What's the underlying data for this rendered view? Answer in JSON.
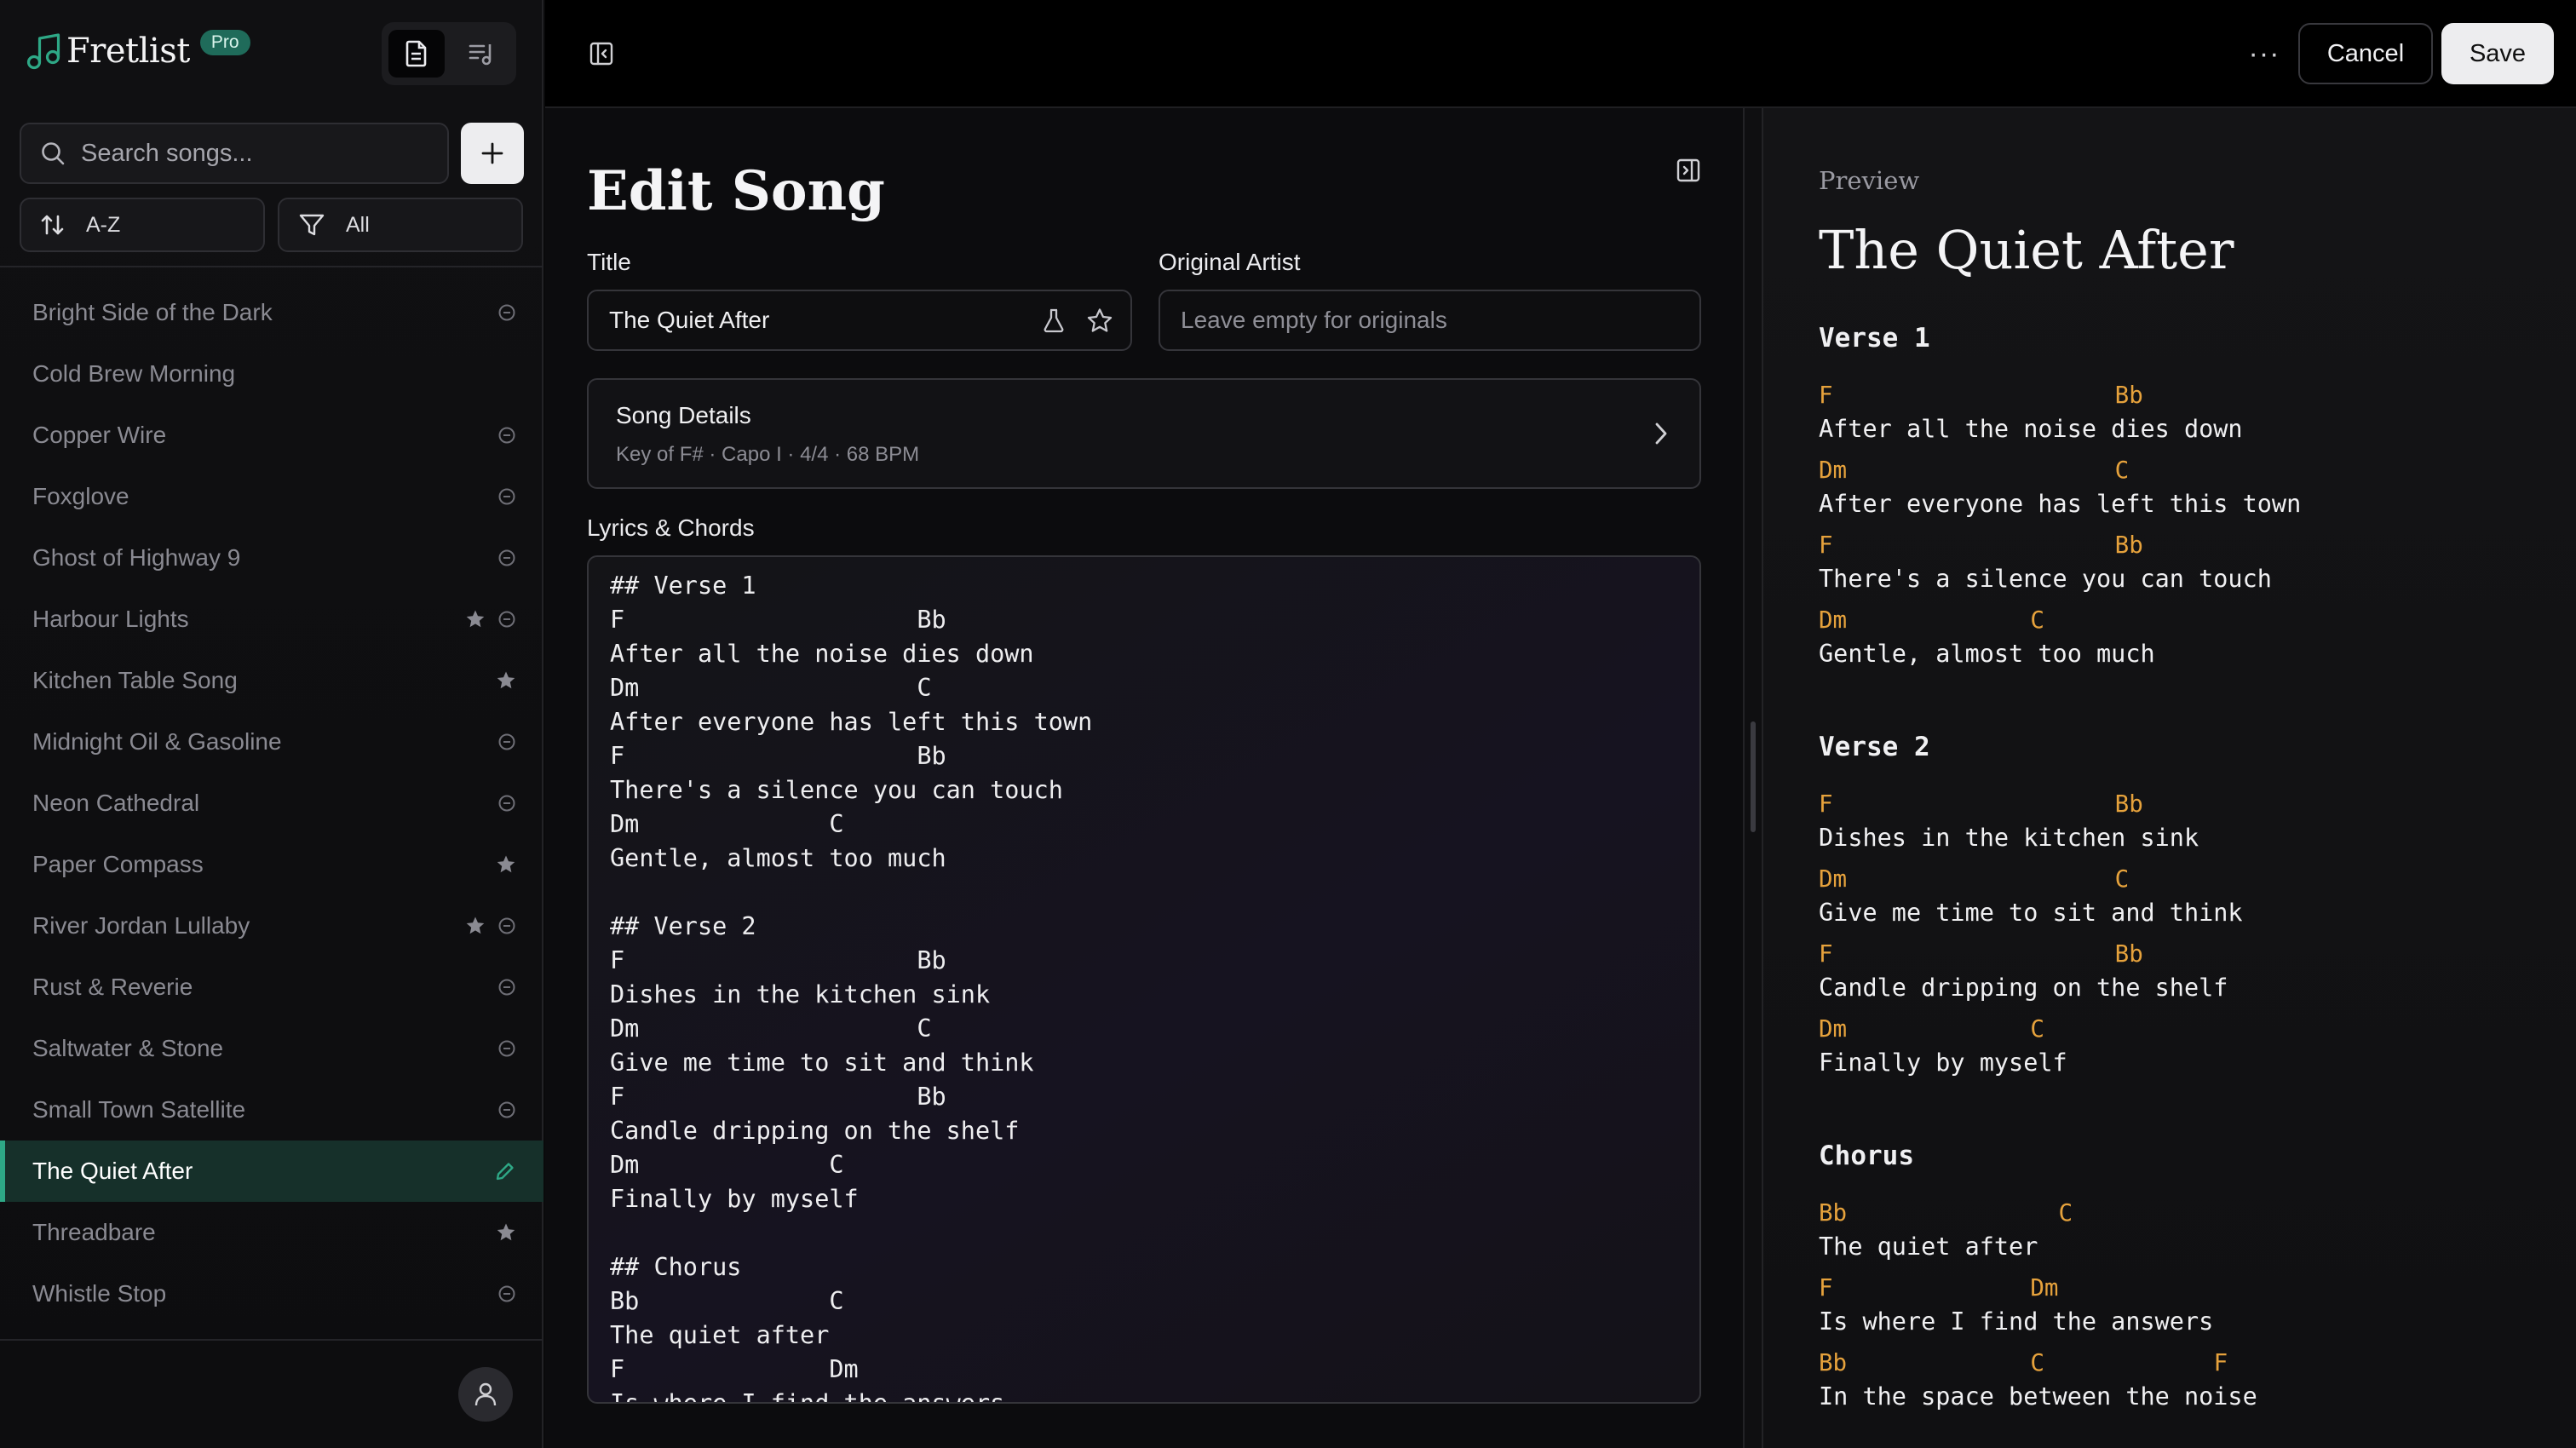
{
  "app": {
    "name": "Fretlist",
    "badge": "Pro",
    "accent_color": "#2ea886",
    "chord_color": "#e6a23c"
  },
  "sidebar": {
    "search_placeholder": "Search songs...",
    "sort_label": "A-Z",
    "filter_label": "All",
    "songs": [
      {
        "title": "Bright Side of the Dark",
        "starred": false,
        "status_icon": true
      },
      {
        "title": "Cold Brew Morning",
        "starred": false,
        "status_icon": false
      },
      {
        "title": "Copper Wire",
        "starred": false,
        "status_icon": true
      },
      {
        "title": "Foxglove",
        "starred": false,
        "status_icon": true
      },
      {
        "title": "Ghost of Highway 9",
        "starred": false,
        "status_icon": true
      },
      {
        "title": "Harbour Lights",
        "starred": true,
        "status_icon": true
      },
      {
        "title": "Kitchen Table Song",
        "starred": true,
        "status_icon": false
      },
      {
        "title": "Midnight Oil & Gasoline",
        "starred": false,
        "status_icon": true
      },
      {
        "title": "Neon Cathedral",
        "starred": false,
        "status_icon": true
      },
      {
        "title": "Paper Compass",
        "starred": true,
        "status_icon": false
      },
      {
        "title": "River Jordan Lullaby",
        "starred": true,
        "status_icon": true
      },
      {
        "title": "Rust & Reverie",
        "starred": false,
        "status_icon": true
      },
      {
        "title": "Saltwater & Stone",
        "starred": false,
        "status_icon": true
      },
      {
        "title": "Small Town Satellite",
        "starred": false,
        "status_icon": true
      },
      {
        "title": "The Quiet After",
        "starred": false,
        "status_icon": false,
        "active": true
      },
      {
        "title": "Threadbare",
        "starred": true,
        "status_icon": false
      },
      {
        "title": "Whistle Stop",
        "starred": false,
        "status_icon": true
      }
    ]
  },
  "toolbar": {
    "more_label": "···",
    "cancel_label": "Cancel",
    "save_label": "Save"
  },
  "editor": {
    "heading": "Edit Song",
    "title_label": "Title",
    "title_value": "The Quiet After",
    "artist_label": "Original Artist",
    "artist_placeholder": "Leave empty for originals",
    "details_title": "Song Details",
    "details_summary": "Key of F# · Capo I · 4/4 · 68 BPM",
    "lyrics_label": "Lyrics & Chords",
    "lyrics": "## Verse 1\nF                    Bb\nAfter all the noise dies down\nDm                   C\nAfter everyone has left this town\nF                    Bb\nThere's a silence you can touch\nDm             C\nGentle, almost too much\n\n## Verse 2\nF                    Bb\nDishes in the kitchen sink\nDm                   C\nGive me time to sit and think\nF                    Bb\nCandle dripping on the shelf\nDm             C\nFinally by myself\n\n## Chorus\nBb             C\nThe quiet after\nF              Dm\nIs where I find the answers"
  },
  "preview": {
    "label": "Preview",
    "title": "The Quiet After",
    "sections": [
      {
        "name": "Verse 1",
        "lines": [
          {
            "chords": "F                    Bb",
            "lyric": "After all the noise dies down"
          },
          {
            "chords": "Dm                   C",
            "lyric": "After everyone has left this town"
          },
          {
            "chords": "F                    Bb",
            "lyric": "There's a silence you can touch"
          },
          {
            "chords": "Dm             C",
            "lyric": "Gentle, almost too much"
          }
        ]
      },
      {
        "name": "Verse 2",
        "lines": [
          {
            "chords": "F                    Bb",
            "lyric": "Dishes in the kitchen sink"
          },
          {
            "chords": "Dm                   C",
            "lyric": "Give me time to sit and think"
          },
          {
            "chords": "F                    Bb",
            "lyric": "Candle dripping on the shelf"
          },
          {
            "chords": "Dm             C",
            "lyric": "Finally by myself"
          }
        ]
      },
      {
        "name": "Chorus",
        "lines": [
          {
            "chords": "Bb               C",
            "lyric": "The quiet after"
          },
          {
            "chords": "F              Dm",
            "lyric": "Is where I find the answers"
          },
          {
            "chords": "Bb             C            F",
            "lyric": "In the space between the noise"
          }
        ]
      }
    ]
  }
}
